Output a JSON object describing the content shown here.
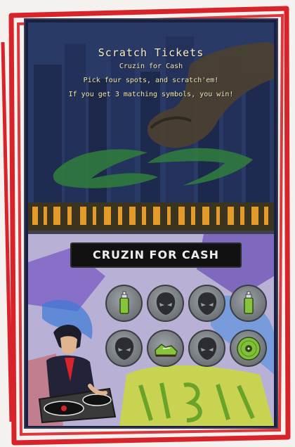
{
  "top_screen": {
    "title": "Scratch Tickets",
    "subtitle": "Cruzin for Cash",
    "instruction_1": "Pick four spots, and scratch'em!",
    "instruction_2": "If you get 3 matching symbols, you win!"
  },
  "bottom_screen": {
    "banner": "CRUZIN FOR CASH",
    "spots_row_1": [
      {
        "symbol": "spray-can",
        "scratched": true
      },
      {
        "symbol": "alien-head",
        "scratched": true
      },
      {
        "symbol": "alien-head",
        "scratched": true
      },
      {
        "symbol": "spray-can",
        "scratched": true
      }
    ],
    "spots_row_2": [
      {
        "symbol": "alien-head",
        "scratched": true
      },
      {
        "symbol": "sneaker",
        "scratched": true
      },
      {
        "symbol": "alien-head",
        "scratched": true
      },
      {
        "symbol": "vinyl-record",
        "scratched": true
      }
    ]
  },
  "colors": {
    "marker_red": "#d8232a",
    "top_text": "#f0e7a6",
    "spot_grey": "#7a7f84",
    "spray_green": "#86c43b"
  }
}
